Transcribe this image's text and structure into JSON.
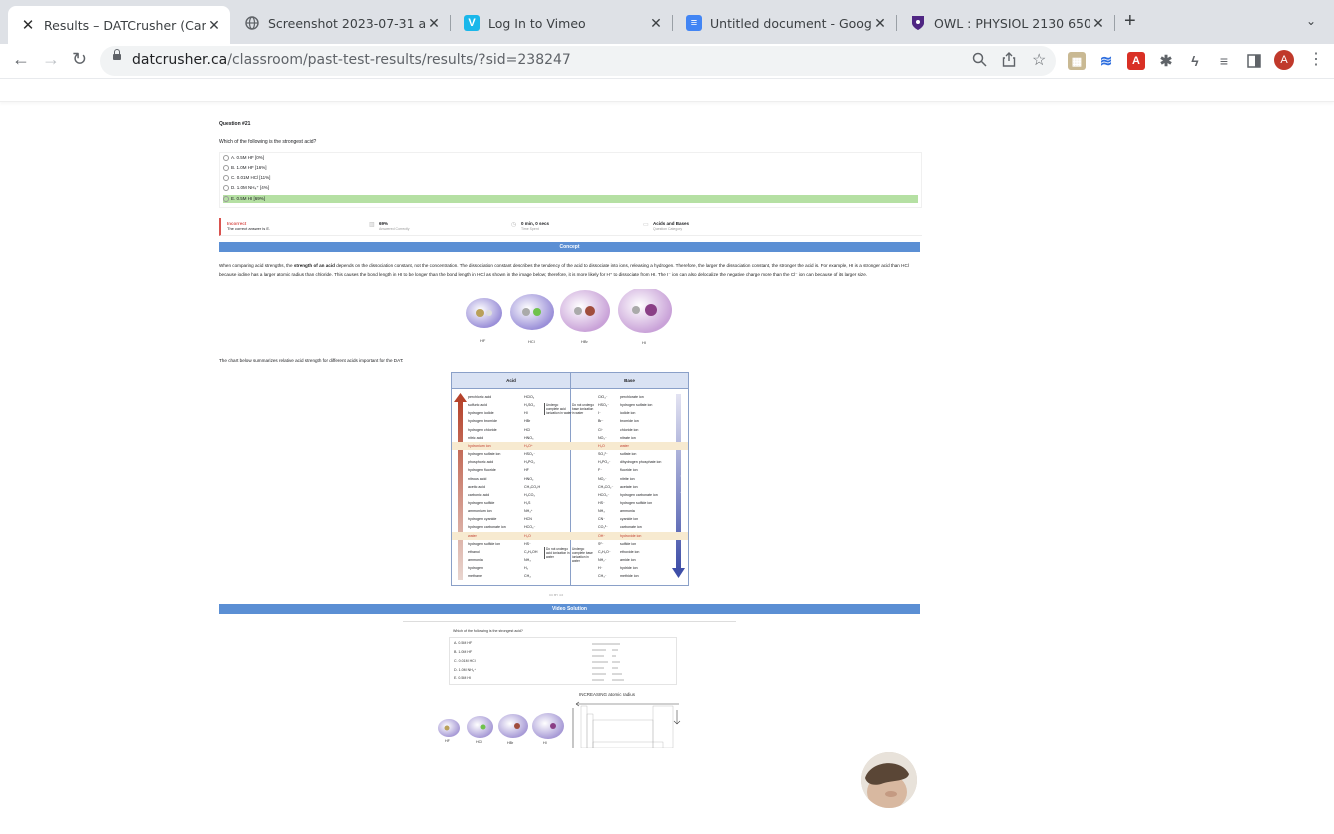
{
  "tabs": [
    {
      "title": "Results – DATCrusher (Canadia",
      "active": true,
      "icon": "datcrusher-icon"
    },
    {
      "title": "Screenshot 2023-07-31 at 5.0",
      "active": false,
      "icon": "globe-icon"
    },
    {
      "title": "Log In to Vimeo",
      "active": false,
      "icon": "vimeo-icon"
    },
    {
      "title": "Untitled document - Google Do",
      "active": false,
      "icon": "google-docs-icon"
    },
    {
      "title": "OWL : PHYSIOL 2130 650 SU2",
      "active": false,
      "icon": "owl-shield-icon"
    }
  ],
  "toolbar": {
    "url_host": "datcrusher.ca",
    "url_path": "/classroom/past-test-results/results/?sid=238247",
    "profile_initial": "A"
  },
  "question": {
    "number": "Question #21",
    "text": "Which of the following is the strongest acid?",
    "options": [
      {
        "label": "A. 0.5M HF [0%]",
        "correct": false
      },
      {
        "label": "B. 1.0M HF [16%]",
        "correct": false
      },
      {
        "label": "C. 0.01M HCl [11%]",
        "correct": false
      },
      {
        "label": "D. 1.0M NH₄⁺ [4%]",
        "correct": false
      },
      {
        "label": "E. 0.5M HI [69%]",
        "correct": true
      }
    ]
  },
  "stats": {
    "result": "Incorrect",
    "result_sub": "The correct answer is E.",
    "percent": "69%",
    "percent_sub": "Answered Correctly",
    "time": "0 min, 0 secs",
    "time_sub": "Time Spent",
    "category": "Acids and Bases",
    "category_sub": "Question Category"
  },
  "concept": {
    "header": "Concept",
    "para_before": "When comparing acid strengths, the ",
    "para_bold": "strength of an acid",
    "para_after": " depends on the dissociation constant, not the concentration. The dissociation constant describes the tendency of the acid to dissociate into ions, releasing a hydrogen. Therefore, the larger the dissociation constant, the stronger the acid is. For example, HI is a stronger acid than HCl because iodine has a larger atomic radius than chloride. This causes the bond length in HI to be longer than the bond length in HCl as shown in the image below; therefore, it is more likely for H⁺ to dissociate from HI. The I⁻ ion can also delocalize the negative charge more than the Cl⁻ ion can because of its larger size.",
    "molecules": [
      "HF",
      "HCl",
      "HBr",
      "HI"
    ],
    "chart_intro": "The chart below summarizes relative acid strength for different acids important for the DAT:",
    "caption": "CC BY 4.0"
  },
  "acid_table": {
    "acid_header": "Acid",
    "base_header": "Base",
    "left_arrow_label": "Increasing acid strength",
    "right_arrow_label": "Increasing base strength",
    "note_strong_acid": "Undergo complete acid ionization in water",
    "note_strong_base": "Do not undergo base ionization in water",
    "note_weak_acid": "Do not undergo acid ionization in water",
    "note_weak_base": "Undergo complete base ionization in water",
    "rows": [
      {
        "acid": "perchloric acid",
        "acid_f": "HClO₄",
        "base_f": "ClO₄⁻",
        "base": "perchlorate ion"
      },
      {
        "acid": "sulfuric acid",
        "acid_f": "H₂SO₄",
        "base_f": "HSO₄⁻",
        "base": "hydrogen sulfate ion"
      },
      {
        "acid": "hydrogen iodide",
        "acid_f": "HI",
        "base_f": "I⁻",
        "base": "iodide ion"
      },
      {
        "acid": "hydrogen bromide",
        "acid_f": "HBr",
        "base_f": "Br⁻",
        "base": "bromide ion"
      },
      {
        "acid": "hydrogen chloride",
        "acid_f": "HCl",
        "base_f": "Cl⁻",
        "base": "chloride ion"
      },
      {
        "acid": "nitric acid",
        "acid_f": "HNO₃",
        "base_f": "NO₃⁻",
        "base": "nitrate ion"
      },
      {
        "acid": "hydronium ion",
        "acid_f": "H₃O⁺",
        "base_f": "H₂O",
        "base": "water",
        "highlight": true
      },
      {
        "acid": "hydrogen sulfate ion",
        "acid_f": "HSO₄⁻",
        "base_f": "SO₄²⁻",
        "base": "sulfate ion"
      },
      {
        "acid": "phosphoric acid",
        "acid_f": "H₃PO₄",
        "base_f": "H₂PO₄⁻",
        "base": "dihydrogen phosphate ion"
      },
      {
        "acid": "hydrogen fluoride",
        "acid_f": "HF",
        "base_f": "F⁻",
        "base": "fluoride ion"
      },
      {
        "acid": "nitrous acid",
        "acid_f": "HNO₂",
        "base_f": "NO₂⁻",
        "base": "nitrite ion"
      },
      {
        "acid": "acetic acid",
        "acid_f": "CH₃CO₂H",
        "base_f": "CH₃CO₂⁻",
        "base": "acetate ion"
      },
      {
        "acid": "carbonic acid",
        "acid_f": "H₂CO₃",
        "base_f": "HCO₃⁻",
        "base": "hydrogen carbonate ion"
      },
      {
        "acid": "hydrogen sulfide",
        "acid_f": "H₂S",
        "base_f": "HS⁻",
        "base": "hydrogen sulfide ion"
      },
      {
        "acid": "ammonium ion",
        "acid_f": "NH₄⁺",
        "base_f": "NH₃",
        "base": "ammonia"
      },
      {
        "acid": "hydrogen cyanide",
        "acid_f": "HCN",
        "base_f": "CN⁻",
        "base": "cyanide ion"
      },
      {
        "acid": "hydrogen carbonate ion",
        "acid_f": "HCO₃⁻",
        "base_f": "CO₃²⁻",
        "base": "carbonate ion"
      },
      {
        "acid": "water",
        "acid_f": "H₂O",
        "base_f": "OH⁻",
        "base": "hydroxide ion",
        "highlight": true
      },
      {
        "acid": "hydrogen sulfide ion",
        "acid_f": "HS⁻",
        "base_f": "S²⁻",
        "base": "sulfide ion"
      },
      {
        "acid": "ethanol",
        "acid_f": "C₂H₅OH",
        "base_f": "C₂H₅O⁻",
        "base": "ethoxide ion"
      },
      {
        "acid": "ammonia",
        "acid_f": "NH₃",
        "base_f": "NH₂⁻",
        "base": "amide ion"
      },
      {
        "acid": "hydrogen",
        "acid_f": "H₂",
        "base_f": "H⁻",
        "base": "hydride ion"
      },
      {
        "acid": "methane",
        "acid_f": "CH₄",
        "base_f": "CH₃⁻",
        "base": "methide ion"
      }
    ]
  },
  "video": {
    "header": "Video Solution",
    "question": "Which of the following is the strongest acid?",
    "options": [
      "A. 0.5M HF",
      "B. 1.0M HF",
      "C. 0.01M HCl",
      "D. 1.0M NH₄⁺",
      "E. 0.5M HI"
    ],
    "hand_note": "INCREASING atomic radius",
    "molecules": [
      "HF",
      "HCl",
      "HBr",
      "HI"
    ]
  }
}
